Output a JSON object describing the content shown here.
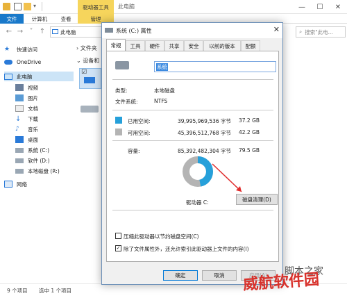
{
  "explorer": {
    "title": "此电脑",
    "contextual_tab": "驱动器工具",
    "ribbon_tabs": {
      "file": "文件",
      "computer": "计算机",
      "view": "查看",
      "manage": "管理"
    },
    "address": "此电脑",
    "search_placeholder": "搜索\"此电...",
    "content_header_folders": "文件夹",
    "content_header_devices": "设备和",
    "sidebar": {
      "quick_access": "快速访问",
      "onedrive": "OneDrive",
      "this_pc": "此电脑",
      "videos": "视频",
      "pictures": "图片",
      "documents": "文档",
      "downloads": "下载",
      "music": "音乐",
      "desktop": "桌面",
      "drive_c": "系统 (C:)",
      "drive_d": "软件 (D:)",
      "drive_r": "本地磁盘 (R:)",
      "network": "网络"
    },
    "status": {
      "items": "9 个项目",
      "selected": "选中 1 个项目"
    }
  },
  "dialog": {
    "title": "系统 (C:) 属性",
    "tabs": {
      "general": "常规",
      "tools": "工具",
      "hardware": "硬件",
      "sharing": "共享",
      "security": "安全",
      "previous": "以前的版本",
      "quota": "配额"
    },
    "name_value": "系统",
    "type_label": "类型:",
    "type_value": "本地磁盘",
    "fs_label": "文件系统:",
    "fs_value": "NTFS",
    "used_label": "已用空间:",
    "used_bytes": "39,995,969,536 字节",
    "used_gb": "37.2 GB",
    "free_label": "可用空间:",
    "free_bytes": "45,396,512,768 字节",
    "free_gb": "42.2 GB",
    "capacity_label": "容量:",
    "capacity_bytes": "85,392,482,304 字节",
    "capacity_gb": "79.5 GB",
    "drive_label": "驱动器 C:",
    "cleanup_button": "磁盘清理(D)",
    "compress_label": "压缩此驱动器以节约磁盘空间(C)",
    "index_label": "除了文件属性外，还允许索引此驱动器上文件的内容(I)",
    "ok": "确定",
    "cancel": "取消",
    "apply": "应用(A)",
    "used_fraction": 0.468,
    "colors": {
      "used": "#26a0da",
      "free": "#b4b4b4"
    }
  },
  "watermark": {
    "text1": "威航软件园",
    "text2": "脚本之家"
  }
}
